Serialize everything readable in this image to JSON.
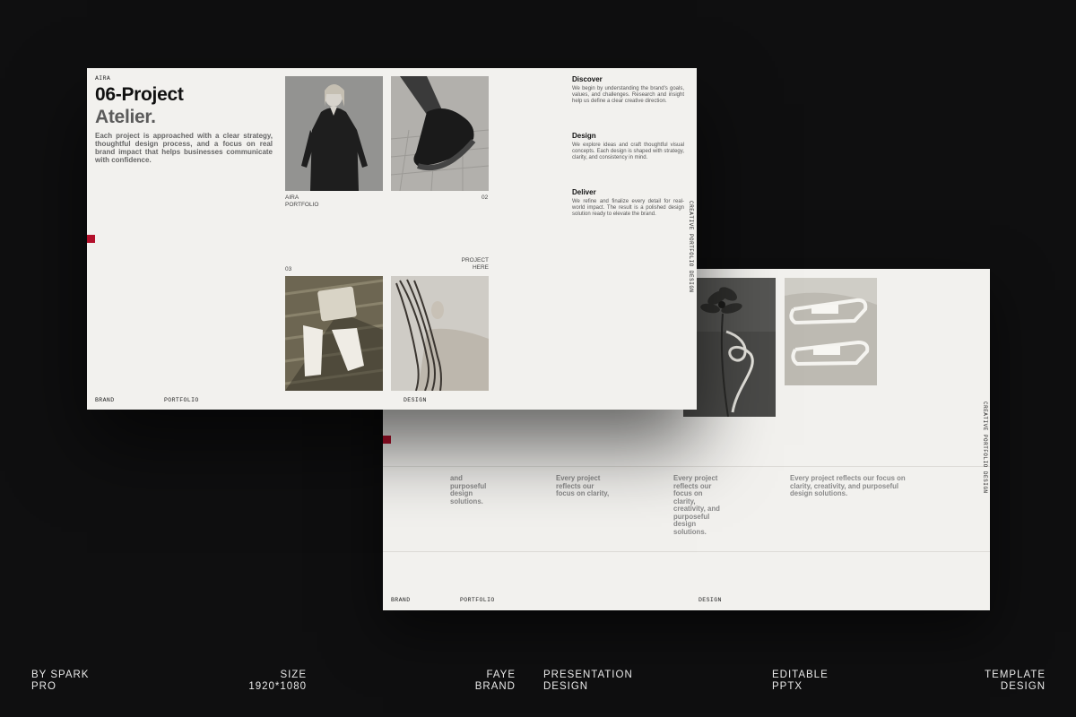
{
  "back_slide": {
    "side_label": "CREATIVE PORTFOLIO DESIGN",
    "blurbs": [
      "and purposeful design solutions.",
      "Every project reflects our focus on clarity,",
      "Every project reflects our focus on clarity, creativity, and purposeful design solutions.",
      "Every project reflects our focus on clarity, creativity, and purposeful design solutions."
    ],
    "footer": {
      "brand": "BRAND",
      "portfolio": "PORTFOLIO",
      "design": "DESIGN"
    }
  },
  "front_slide": {
    "top_label": "AIRA",
    "title_line1": "06-Project",
    "title_line2": "Atelier.",
    "intro": "Each project is approached with a clear strategy, thoughtful design process, and a focus on real brand impact that helps businesses communicate with confidence.",
    "caption_left": "AIRA PORTFOLIO",
    "caption_number_02": "02",
    "caption_number_03": "03",
    "caption_project": "PROJECT HERE",
    "side_label": "CREATIVE PORTFOLIO DESIGN",
    "services": [
      {
        "title": "Discover",
        "text": "We begin by understanding the brand's goals, values, and challenges. Research and insight help us define a clear creative direction."
      },
      {
        "title": "Design",
        "text": "We explore ideas and craft thoughtful visual concepts. Each design is shaped with strategy, clarity, and consistency in mind."
      },
      {
        "title": "Deliver",
        "text": "We refine and finalize every detail for real-world impact. The result is a polished design solution ready to elevate the brand."
      }
    ],
    "footer": {
      "brand": "BRAND",
      "portfolio": "PORTFOLIO",
      "design": "DESIGN"
    }
  },
  "page_footer": {
    "by": "BY SPARK PRO",
    "size": "SIZE 1920*1080",
    "brand": "FAYE BRAND",
    "presentation": "PRESENTATION DESIGN",
    "editable": "EDITABLE PPTX",
    "template": "TEMPLATE DESIGN"
  },
  "colors": {
    "background": "#0f0f10",
    "slide": "#f2f1ee",
    "accent": "#b3102b"
  },
  "icons": [
    "flower-photo",
    "sandals-photo",
    "woman-portrait-photo",
    "boot-photo",
    "bag-sandals-photo",
    "hair-photo"
  ]
}
